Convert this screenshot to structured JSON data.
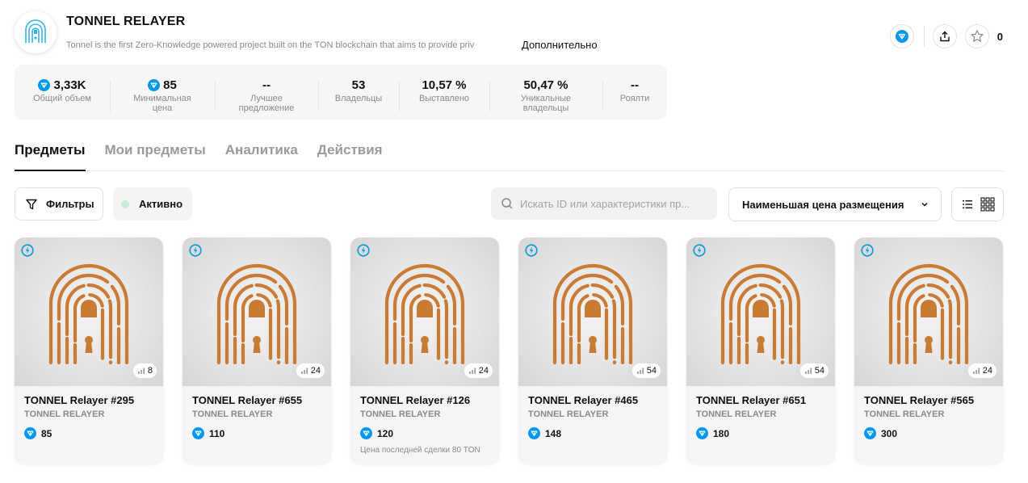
{
  "collection": {
    "title": "TONNEL RELAYER",
    "description": "Tonnel is the first Zero-Knowledge powered project built on the TON blockchain that aims to provide priv",
    "more_label": "Дополнительно",
    "favorites_count": "0"
  },
  "stats": [
    {
      "value": "3,33K",
      "label": "Общий объем",
      "ton": true
    },
    {
      "value": "85",
      "label": "Минимальная цена",
      "ton": true
    },
    {
      "value": "--",
      "label": "Лучшее предложение",
      "ton": false
    },
    {
      "value": "53",
      "label": "Владельцы",
      "ton": false
    },
    {
      "value": "10,57 %",
      "label": "Выставлено",
      "ton": false
    },
    {
      "value": "50,47 %",
      "label": "Уникальные владельцы",
      "ton": false
    },
    {
      "value": "--",
      "label": "Роялти",
      "ton": false
    }
  ],
  "tabs": [
    {
      "label": "Предметы",
      "active": true
    },
    {
      "label": "Мои предметы",
      "active": false
    },
    {
      "label": "Аналитика",
      "active": false
    },
    {
      "label": "Действия",
      "active": false
    }
  ],
  "toolbar": {
    "filters_label": "Фильтры",
    "active_label": "Активно",
    "search_placeholder": "Искать ID или характеристики пр...",
    "sort_label": "Наименьшая цена размещения"
  },
  "items": [
    {
      "name": "TONNEL Relayer #295",
      "collection": "TONNEL RELAYER",
      "price": "85",
      "rarity": "8",
      "note": ""
    },
    {
      "name": "TONNEL Relayer #655",
      "collection": "TONNEL RELAYER",
      "price": "110",
      "rarity": "24",
      "note": ""
    },
    {
      "name": "TONNEL Relayer #126",
      "collection": "TONNEL RELAYER",
      "price": "120",
      "rarity": "24",
      "note": "Цена последней сделки 80 TON"
    },
    {
      "name": "TONNEL Relayer #465",
      "collection": "TONNEL RELAYER",
      "price": "148",
      "rarity": "54",
      "note": ""
    },
    {
      "name": "TONNEL Relayer #651",
      "collection": "TONNEL RELAYER",
      "price": "180",
      "rarity": "54",
      "note": ""
    },
    {
      "name": "TONNEL Relayer #565",
      "collection": "TONNEL RELAYER",
      "price": "300",
      "rarity": "24",
      "note": ""
    }
  ],
  "colors": {
    "ton_blue": "#0098ea",
    "nft_orange": "#c97a34",
    "logo_cyan": "#33b6e6",
    "active_dot": "#c8ecd8"
  },
  "icons": {
    "verified": "verified-badge-icon",
    "share": "share-icon",
    "favorite": "star-icon",
    "filters": "funnel-icon",
    "search": "search-icon",
    "sort": "chevron-down-icon",
    "list_view": "list-view-icon",
    "grid_view": "grid-view-icon",
    "lightning": "lightning-badge-icon",
    "rarity": "signal-bars-icon"
  }
}
